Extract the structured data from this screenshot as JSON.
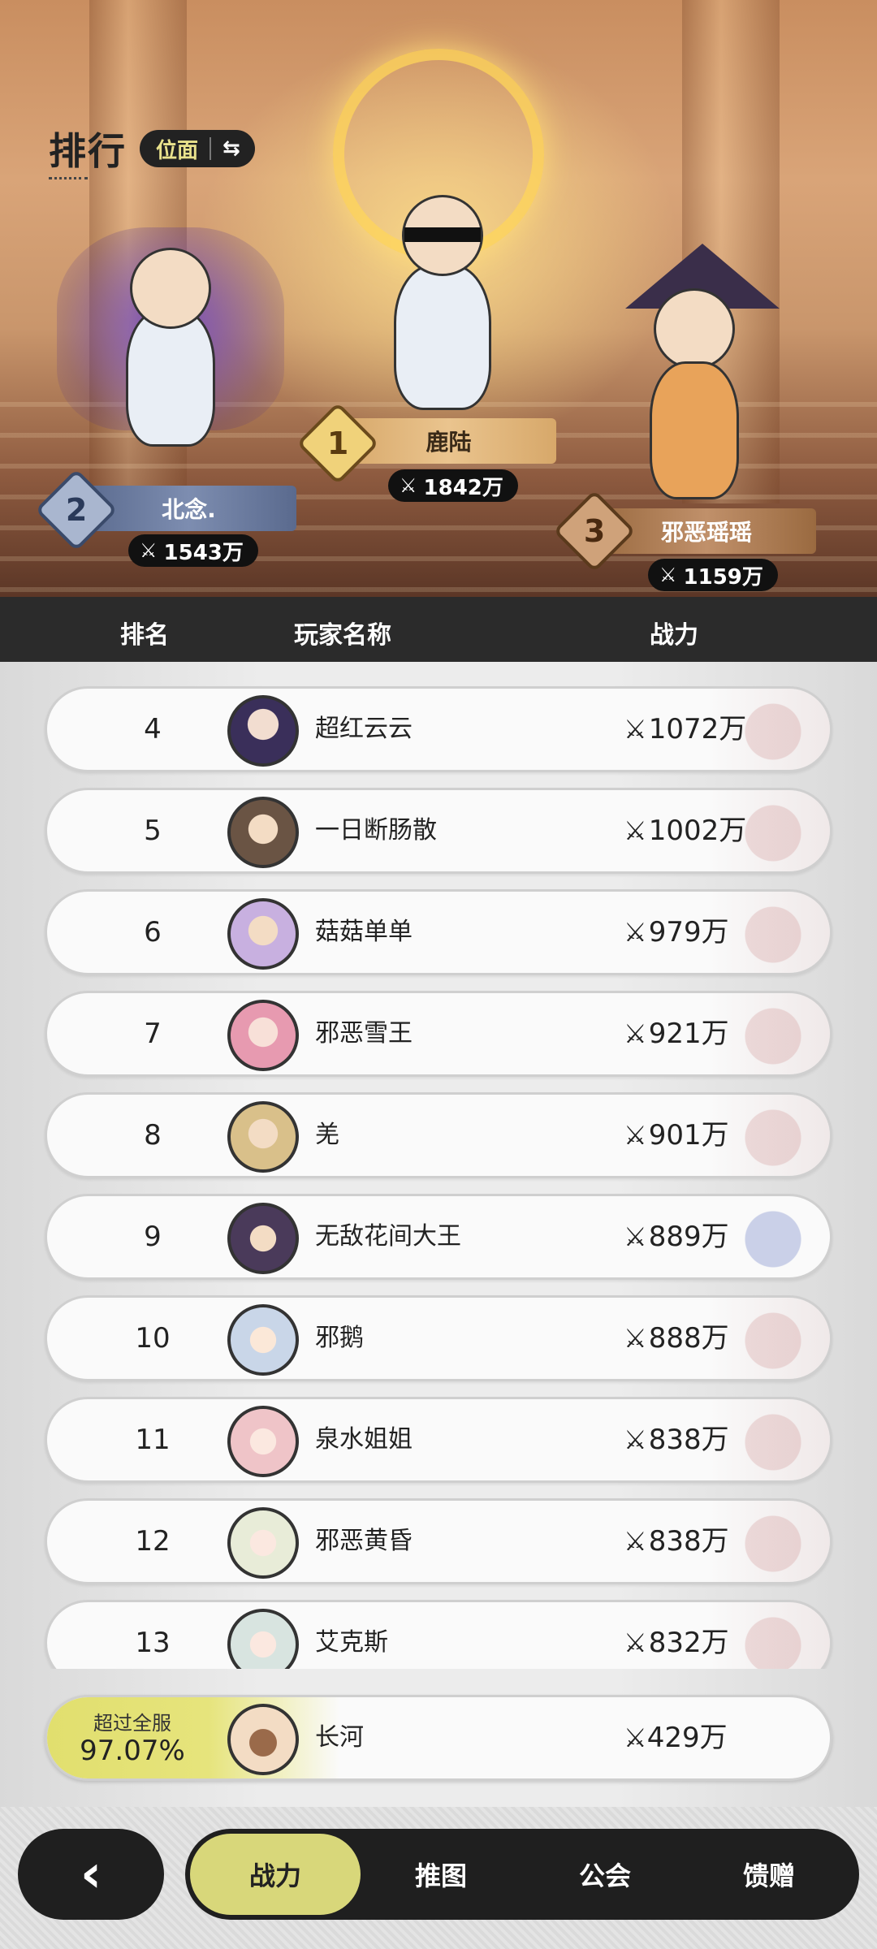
{
  "header": {
    "title": "排行",
    "mode_label": "位面",
    "swap_icon": "swap-icon"
  },
  "podium": [
    {
      "rank": "1",
      "name": "鹿陆",
      "power": "1842万"
    },
    {
      "rank": "2",
      "name": "北念.",
      "power": "1543万"
    },
    {
      "rank": "3",
      "name": "邪恶瑶瑶",
      "power": "1159万"
    }
  ],
  "columns": {
    "rank": "排名",
    "player": "玩家名称",
    "power": "战力"
  },
  "rows": [
    {
      "rank": "4",
      "name": "超红云云",
      "power": "1072万"
    },
    {
      "rank": "5",
      "name": "一日断肠散",
      "power": "1002万"
    },
    {
      "rank": "6",
      "name": "菇菇单单",
      "power": "979万"
    },
    {
      "rank": "7",
      "name": "邪恶雪王",
      "power": "921万"
    },
    {
      "rank": "8",
      "name": "羌",
      "power": "901万"
    },
    {
      "rank": "9",
      "name": "无敌花间大王",
      "power": "889万"
    },
    {
      "rank": "10",
      "name": "邪鹅",
      "power": "888万"
    },
    {
      "rank": "11",
      "name": "泉水姐姐",
      "power": "838万"
    },
    {
      "rank": "12",
      "name": "邪恶黄昏",
      "power": "838万"
    },
    {
      "rank": "13",
      "name": "艾克斯",
      "power": "832万"
    }
  ],
  "me": {
    "label": "超过全服",
    "percent": "97.07%",
    "name": "长河",
    "power": "429万"
  },
  "nav": {
    "back_icon": "chevron-left-icon",
    "tabs": [
      {
        "label": "战力",
        "active": true
      },
      {
        "label": "推图",
        "active": false
      },
      {
        "label": "公会",
        "active": false
      },
      {
        "label": "馈赠",
        "active": false
      }
    ]
  },
  "colors": {
    "accent": "#d8d77a",
    "dark": "#1f1f1f",
    "header_bar": "#2b2b2b",
    "highlight": "#e1df6e"
  }
}
